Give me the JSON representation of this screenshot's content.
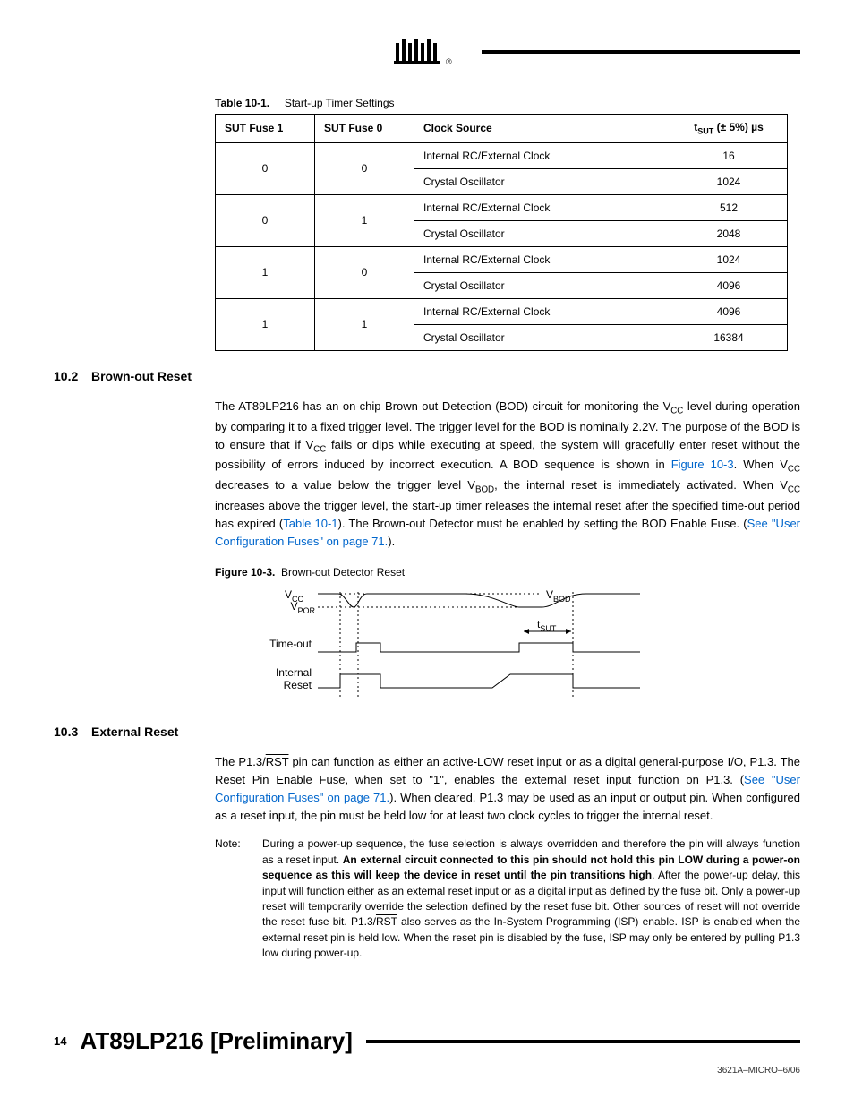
{
  "table": {
    "label": "Table 10-1.",
    "title": "Start-up Timer Settings",
    "headers": {
      "c0": "SUT Fuse 1",
      "c1": "SUT Fuse 0",
      "c2": "Clock Source",
      "c3_pre": "t",
      "c3_sub": "SUT",
      "c3_post": " (± 5%) µs"
    },
    "rows": [
      {
        "f1": "0",
        "f0": "0",
        "src": "Internal RC/External Clock",
        "t": "16"
      },
      {
        "src": "Crystal Oscillator",
        "t": "1024"
      },
      {
        "f1": "0",
        "f0": "1",
        "src": "Internal RC/External Clock",
        "t": "512"
      },
      {
        "src": "Crystal Oscillator",
        "t": "2048"
      },
      {
        "f1": "1",
        "f0": "0",
        "src": "Internal RC/External Clock",
        "t": "1024"
      },
      {
        "src": "Crystal Oscillator",
        "t": "4096"
      },
      {
        "f1": "1",
        "f0": "1",
        "src": "Internal RC/External Clock",
        "t": "4096"
      },
      {
        "src": "Crystal Oscillator",
        "t": "16384"
      }
    ]
  },
  "sec102": {
    "num": "10.2",
    "title": "Brown-out Reset",
    "p1a": "The AT89LP216 has an on-chip Brown-out Detection (BOD) circuit for monitoring the V",
    "p1a_sub": "CC",
    "p1b": " level during operation by comparing it to a fixed trigger level. The trigger level for the BOD is nominally 2.2V. The purpose of the BOD is to ensure that if V",
    "p1b_sub": "CC",
    "p1c": " fails or dips while executing at speed, the system will gracefully enter reset without the possibility of errors induced by incorrect execution. A BOD sequence is shown in ",
    "link1": "Figure 10-3",
    "p1d": ". When V",
    "p1d_sub": "CC",
    "p1e": " decreases to a value below the trigger level V",
    "p1e_sub": "BOD",
    "p1f": ", the internal reset is immediately activated. When V",
    "p1f_sub": "CC",
    "p1g": " increases above the trigger level, the start-up timer releases the internal reset after the specified time-out period has expired (",
    "link2": "Table 10-1",
    "p1h": "). The Brown-out Detector must be enabled by setting the BOD Enable Fuse. (",
    "link3": "See \"User Configuration Fuses\" on page 71.",
    "p1i": ")."
  },
  "fig": {
    "label": "Figure 10-3.",
    "title": "Brown-out Detector Reset",
    "vcc": "V",
    "vcc_sub": "CC",
    "vpor": "V",
    "vpor_sub": "POR",
    "vbod": "V",
    "vbod_sub": "BOD",
    "tsut": "t",
    "tsut_sub": "SUT",
    "timeout": "Time-out",
    "internal": "Internal",
    "reset": "Reset"
  },
  "sec103": {
    "num": "10.3",
    "title": "External Reset",
    "p1a": "The P1.3/",
    "rst": "RST",
    "p1b": " pin can function as either an active-LOW reset input or as a digital general-purpose I/O, P1.3. The Reset Pin Enable Fuse, when set to \"1\", enables the external reset input function on P1.3. (",
    "link1": "See \"User Configuration Fuses\" on page 71.",
    "p1c": "). When cleared, P1.3 may be used as an input or output pin. When configured as a reset input, the pin must be held low for at least two clock cycles to trigger the internal reset.",
    "note_label": "Note:",
    "note_a": "During a power-up sequence, the fuse selection is always overridden and therefore the pin will always function as a reset input. ",
    "note_bold": "An external circuit connected to this pin should not hold this pin LOW during a power-on sequence as this will keep the device in reset until the pin transitions high",
    "note_b": ". After the power-up delay, this input will function either as an external reset input or as a digital input as defined by the fuse bit. Only a power-up reset will temporarily override the selection defined by the reset fuse bit. Other sources of reset will not override the reset fuse bit. P1.3/",
    "note_c": " also serves as the In-System Programming (ISP) enable. ISP is enabled when the external reset pin is held low. When the reset pin is disabled by the fuse, ISP may only be entered by pulling P1.3 low during power-up."
  },
  "footer": {
    "page": "14",
    "title": "AT89LP216 [Preliminary]",
    "docid": "3621A–MICRO–6/06"
  }
}
